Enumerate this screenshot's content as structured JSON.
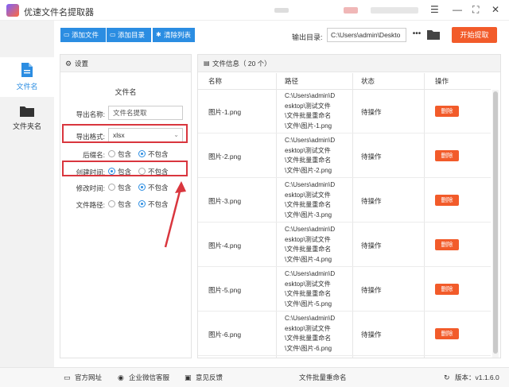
{
  "app": {
    "title": "优速文件名提取器"
  },
  "sidebar": {
    "items": [
      {
        "label": "文件名",
        "icon": "file-icon",
        "active": true
      },
      {
        "label": "文件夹名",
        "icon": "folder-icon",
        "active": false
      }
    ]
  },
  "toolbar": {
    "add_file": "添加文件",
    "add_dir": "添加目录",
    "clear_list": "清除列表",
    "output_label": "输出目录:",
    "output_path": "C:\\Users\\admin\\Deskto",
    "more": "•••",
    "start": "开始提取"
  },
  "settings": {
    "header": "设置",
    "section": "文件名",
    "export_name_label": "导出名称:",
    "export_name_value": "文件名提取",
    "export_format_label": "导出格式:",
    "export_format_value": "xlsx",
    "rows": [
      {
        "label": "后缀名:",
        "opt1": "包含",
        "opt2": "不包含",
        "selected": 2
      },
      {
        "label": "创建时间:",
        "opt1": "包含",
        "opt2": "不包含",
        "selected": 1
      },
      {
        "label": "修改时间:",
        "opt1": "包含",
        "opt2": "不包含",
        "selected": 2
      },
      {
        "label": "文件路径:",
        "opt1": "包含",
        "opt2": "不包含",
        "selected": 2
      }
    ]
  },
  "filelist": {
    "header": "文件信息（ 20 个）",
    "columns": {
      "name": "名称",
      "path": "路径",
      "status": "状态",
      "action": "操作"
    },
    "rows": [
      {
        "name": "图片-1.png",
        "path_lines": [
          "C:\\Users\\admin\\D",
          "esktop\\测试文件",
          "\\文件批量重命名",
          "\\文件\\图片-1.png"
        ],
        "status": "待操作",
        "action": "删除"
      },
      {
        "name": "图片-2.png",
        "path_lines": [
          "C:\\Users\\admin\\D",
          "esktop\\测试文件",
          "\\文件批量重命名",
          "\\文件\\图片-2.png"
        ],
        "status": "待操作",
        "action": "删除"
      },
      {
        "name": "图片-3.png",
        "path_lines": [
          "C:\\Users\\admin\\D",
          "esktop\\测试文件",
          "\\文件批量重命名",
          "\\文件\\图片-3.png"
        ],
        "status": "待操作",
        "action": "删除"
      },
      {
        "name": "图片-4.png",
        "path_lines": [
          "C:\\Users\\admin\\D",
          "esktop\\测试文件",
          "\\文件批量重命名",
          "\\文件\\图片-4.png"
        ],
        "status": "待操作",
        "action": "删除"
      },
      {
        "name": "图片-5.png",
        "path_lines": [
          "C:\\Users\\admin\\D",
          "esktop\\测试文件",
          "\\文件批量重命名",
          "\\文件\\图片-5.png"
        ],
        "status": "待操作",
        "action": "删除"
      },
      {
        "name": "图片-6.png",
        "path_lines": [
          "C:\\Users\\admin\\D",
          "esktop\\测试文件",
          "\\文件批量重命名",
          "\\文件\\图片-6.png"
        ],
        "status": "待操作",
        "action": "删除"
      }
    ]
  },
  "footer": {
    "website": "官方网址",
    "wechat": "企业微信客服",
    "feedback": "意见反馈",
    "center": "文件批量重命名",
    "version": "版本：v1.1.6.0"
  },
  "colors": {
    "accent": "#2b8de2",
    "action": "#f25b2a",
    "highlight": "#d9363e"
  }
}
